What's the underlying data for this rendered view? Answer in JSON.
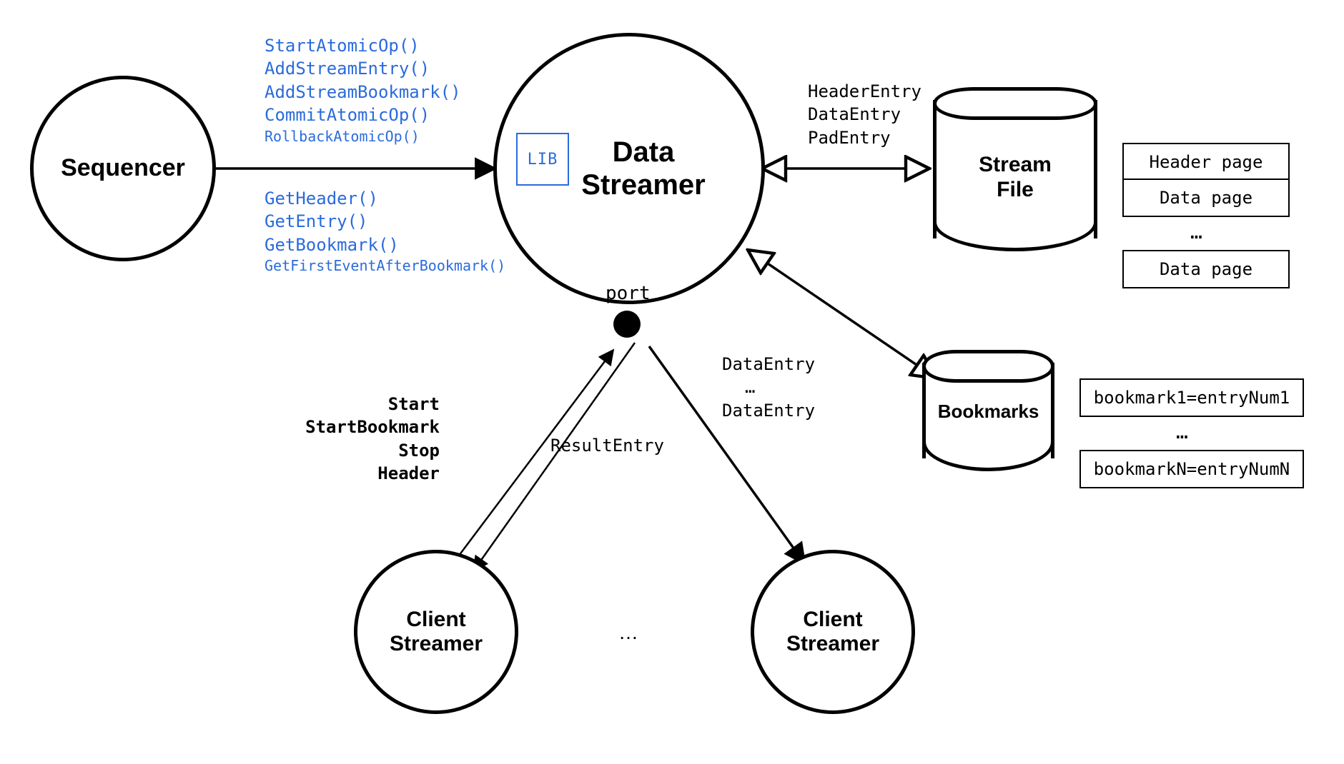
{
  "nodes": {
    "sequencer": "Sequencer",
    "data_streamer_l1": "Data",
    "data_streamer_l2": "Streamer",
    "lib": "LIB",
    "port": "port",
    "client_streamer_l1": "Client",
    "client_streamer_l2": "Streamer",
    "stream_file_l1": "Stream",
    "stream_file_l2": "File",
    "bookmarks": "Bookmarks"
  },
  "api": {
    "write": [
      "StartAtomicOp()",
      "AddStreamEntry()",
      "AddStreamBookmark()",
      "CommitAtomicOp()",
      "RollbackAtomicOp()"
    ],
    "read": [
      "GetHeader()",
      "GetEntry()",
      "GetBookmark()",
      "GetFirstEventAfterBookmark()"
    ]
  },
  "messages": {
    "file_entries": [
      "HeaderEntry",
      "DataEntry",
      "PadEntry"
    ],
    "commands": [
      "Start",
      "StartBookmark",
      "Stop",
      "Header"
    ],
    "result": "ResultEntry",
    "data_stream": [
      "DataEntry",
      "…",
      "DataEntry"
    ]
  },
  "pages": {
    "header": "Header page",
    "data": "Data page",
    "ellipsis": "…"
  },
  "bookmarks_list": {
    "first": "bookmark1=entryNum1",
    "ellipsis": "…",
    "last": "bookmarkN=entryNumN"
  },
  "ellipsis": "…"
}
